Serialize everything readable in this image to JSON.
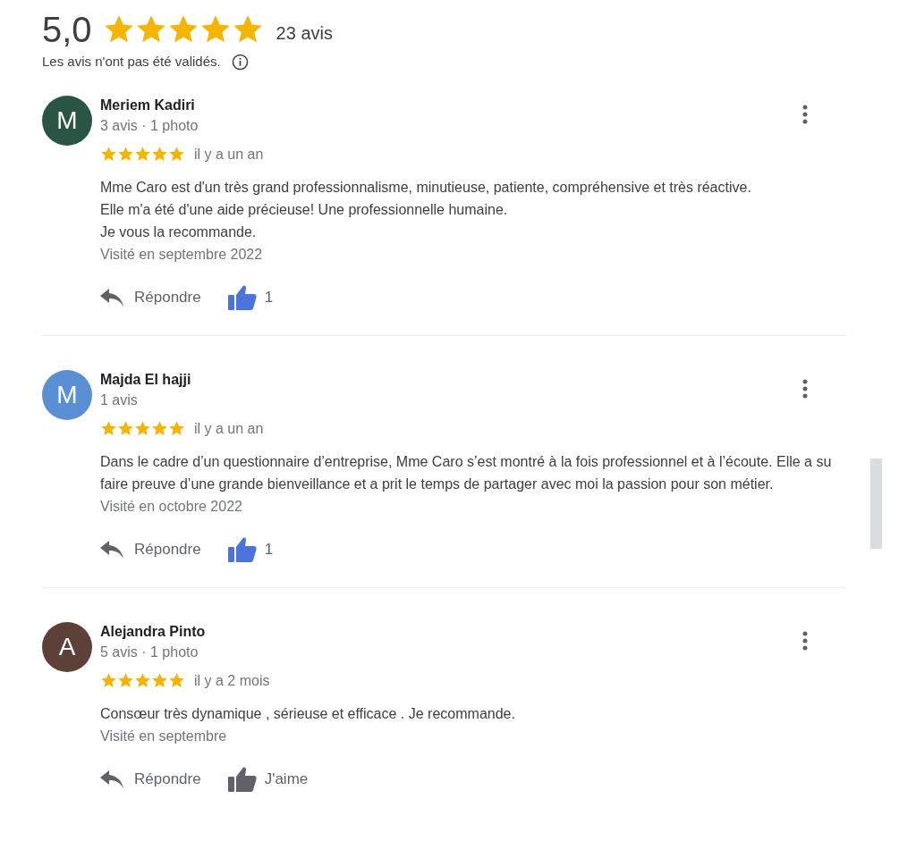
{
  "summary": {
    "rating": "5,0",
    "stars": 5,
    "count": "23 avis",
    "notice": "Les avis n'ont pas été validés."
  },
  "reviews": [
    {
      "initial": "M",
      "color": "#2a5545",
      "name": "Meriem Kadiri",
      "meta": "3 avis · 1 photo",
      "stars": 5,
      "time": "il y a un an",
      "text": "Mme Caro est d'un très grand professionnalisme, minutieuse, patiente, compréhensive et très réactive.\nElle m'a été d'une aide précieuse! Une professionnelle humaine.\nJe vous la recommande.",
      "visited": "Visité en septembre 2022",
      "reply": "Répondre",
      "liked": true,
      "like_label": "1"
    },
    {
      "initial": "M",
      "color": "#5b8fd4",
      "name": "Majda El hajji",
      "meta": "1 avis",
      "stars": 5,
      "time": "il y a un an",
      "text": "Dans le cadre d’un questionnaire d’entreprise, Mme Caro s’est montré à la fois professionnel et à l’écoute. Elle a su faire preuve d’une grande bienveillance et a prit le temps de partager avec moi la passion pour son métier.",
      "visited": "Visité en octobre 2022",
      "reply": "Répondre",
      "liked": true,
      "like_label": "1"
    },
    {
      "initial": "A",
      "color": "#5d4037",
      "name": "Alejandra Pinto",
      "meta": "5 avis · 1 photo",
      "stars": 5,
      "time": "il y a 2 mois",
      "text": "Consœur très dynamique , sérieuse et efficace . Je recommande.",
      "visited": "Visité en septembre",
      "reply": "Répondre",
      "liked": false,
      "like_label": "J'aime"
    }
  ]
}
